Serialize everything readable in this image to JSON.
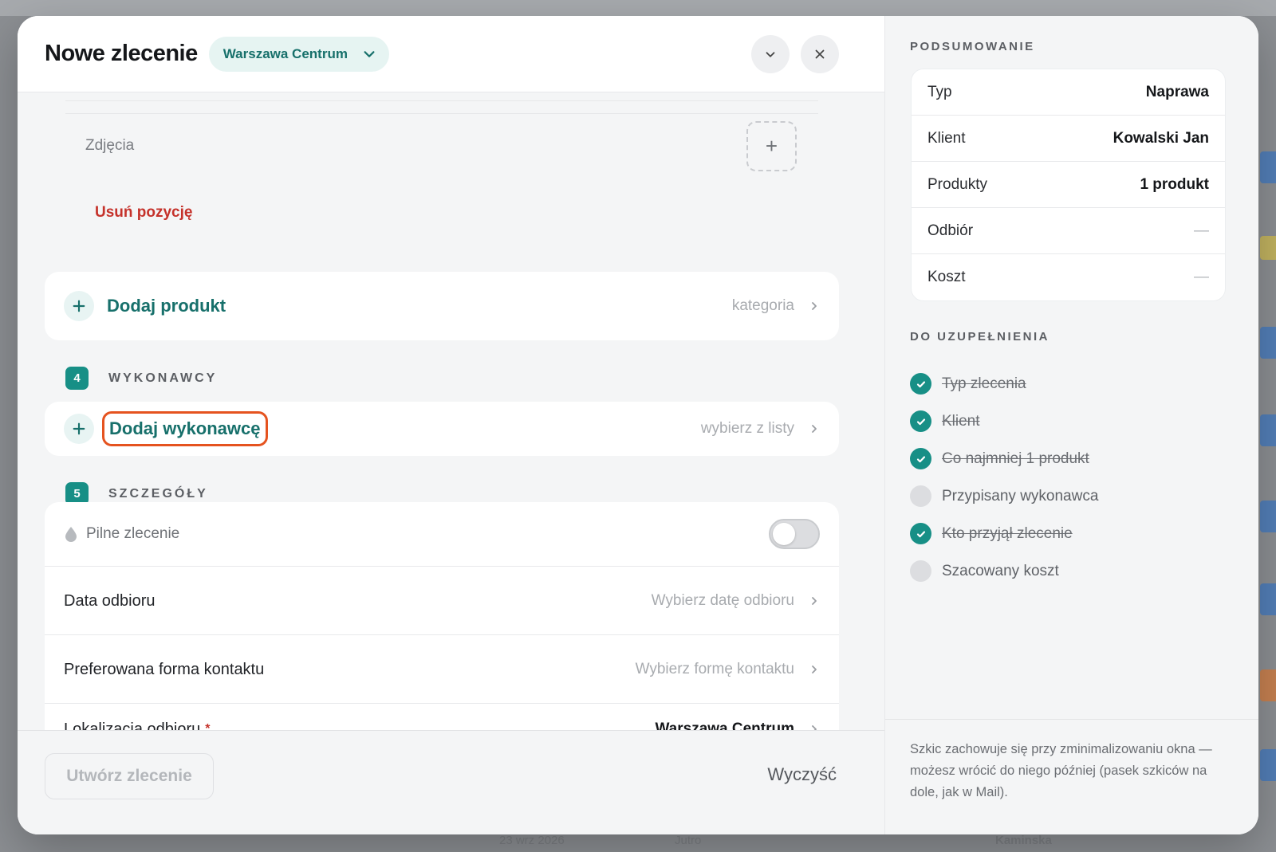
{
  "background": {
    "bottom_texts": [
      "23 wrz 2026",
      "Jutro",
      "Kaminska"
    ]
  },
  "header": {
    "title": "Nowe zlecenie",
    "location": "Warszawa Centrum"
  },
  "photos": {
    "label": "Zdjęcia",
    "remove_label": "Usuń pozycję"
  },
  "add_product": {
    "label": "Dodaj produkt",
    "hint": "kategoria"
  },
  "section_contractors": {
    "number": "4",
    "title": "WYKONAWCY",
    "add_label": "Dodaj wykonawcę",
    "hint": "wybierz z listy"
  },
  "section_details": {
    "number": "5",
    "title": "SZCZEGÓŁY",
    "urgent_label": "Pilne zlecenie",
    "urgent_on": false,
    "rows": [
      {
        "label": "Data odbioru",
        "value": "Wybierz datę odbioru"
      },
      {
        "label": "Preferowana forma kontaktu",
        "value": "Wybierz formę kontaktu"
      },
      {
        "label": "Lokalizacja odbioru",
        "required_mark": "*",
        "value": "Warszawa Centrum"
      }
    ]
  },
  "footer": {
    "create_label": "Utwórz zlecenie",
    "clear_label": "Wyczyść"
  },
  "summary": {
    "heading": "PODSUMOWANIE",
    "rows": [
      {
        "key": "Typ",
        "value": "Naprawa"
      },
      {
        "key": "Klient",
        "value": "Kowalski Jan"
      },
      {
        "key": "Produkty",
        "value": "1 produkt"
      },
      {
        "key": "Odbiór",
        "value": "—"
      },
      {
        "key": "Koszt",
        "value": "—"
      }
    ]
  },
  "todo": {
    "heading": "DO UZUPEŁNIENIA",
    "items": [
      {
        "label": "Typ zlecenia",
        "done": true
      },
      {
        "label": "Klient",
        "done": true
      },
      {
        "label": "Co najmniej 1 produkt",
        "done": true
      },
      {
        "label": "Przypisany wykonawca",
        "done": false
      },
      {
        "label": "Kto przyjął zlecenie",
        "done": true
      },
      {
        "label": "Szacowany koszt",
        "done": false
      }
    ]
  },
  "note": "Szkic zachowuje się przy zminimalizowaniu okna — możesz wrócić do niego później (pasek szkiców na dole, jak w Mail).",
  "colors": {
    "accent": "#178f86",
    "accent_text": "#17706b",
    "danger": "#c5322b",
    "focus": "#e5531f"
  }
}
